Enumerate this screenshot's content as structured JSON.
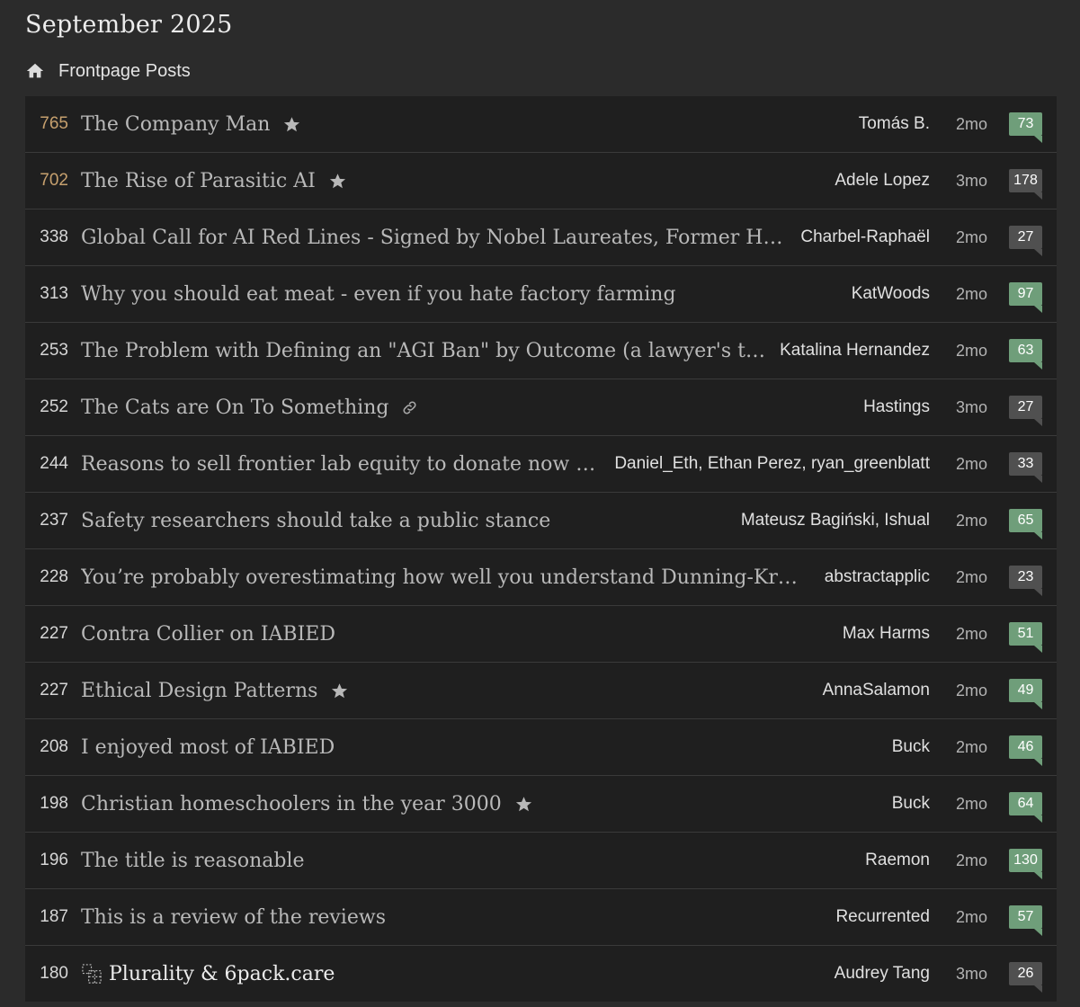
{
  "month_title": "September 2025",
  "section": {
    "icon": "home-icon",
    "label": "Frontpage Posts"
  },
  "colors": {
    "high_karma": "#c6a06e",
    "comments_green": "#6f9e7a",
    "comments_gray": "#505050",
    "row_bg": "#1f1f1f"
  },
  "posts": [
    {
      "karma": "765",
      "title": "The Company Man",
      "author": "Tomás B.",
      "age": "2mo",
      "comments": "73",
      "icon": "star-icon"
    },
    {
      "karma": "702",
      "title": "The Rise of Parasitic AI",
      "author": "Adele Lopez",
      "age": "3mo",
      "comments": "178",
      "icon": "star-icon"
    },
    {
      "karma": "338",
      "title": "Global Call for AI Red Lines - Signed by Nobel Laureates, Former Heads…",
      "author": "Charbel-Raphaël",
      "age": "2mo",
      "comments": "27"
    },
    {
      "karma": "313",
      "title": "Why you should eat meat - even if you hate factory farming",
      "author": "KatWoods",
      "age": "2mo",
      "comments": "97"
    },
    {
      "karma": "253",
      "title": "The Problem with Defining an \"AGI Ban\" by Outcome (a lawyer's take…",
      "author": "Katalina Hernandez",
      "age": "2mo",
      "comments": "63"
    },
    {
      "karma": "252",
      "title": "The Cats are On To Something",
      "author": "Hastings",
      "age": "3mo",
      "comments": "27",
      "icon": "link-icon"
    },
    {
      "karma": "244",
      "title": "Reasons to sell frontier lab equity to donate now rat…",
      "author": "Daniel_Eth, Ethan Perez, ryan_greenblatt",
      "age": "2mo",
      "comments": "33"
    },
    {
      "karma": "237",
      "title": "Safety researchers should take a public stance",
      "author": "Mateusz Bagiński, Ishual",
      "age": "2mo",
      "comments": "65"
    },
    {
      "karma": "228",
      "title": "You’re probably overestimating how well you understand Dunning-Kruger",
      "author": "abstractapplic",
      "age": "2mo",
      "comments": "23"
    },
    {
      "karma": "227",
      "title": "Contra Collier on IABIED",
      "author": "Max Harms",
      "age": "2mo",
      "comments": "51"
    },
    {
      "karma": "227",
      "title": "Ethical Design Patterns",
      "author": "AnnaSalamon",
      "age": "2mo",
      "comments": "49",
      "icon": "star-icon"
    },
    {
      "karma": "208",
      "title": "I enjoyed most of IABIED",
      "author": "Buck",
      "age": "2mo",
      "comments": "46"
    },
    {
      "karma": "198",
      "title": "Christian homeschoolers in the year 3000",
      "author": "Buck",
      "age": "2mo",
      "comments": "64",
      "icon": "star-icon"
    },
    {
      "karma": "196",
      "title": "The title is reasonable",
      "author": "Raemon",
      "age": "2mo",
      "comments": "130"
    },
    {
      "karma": "187",
      "title": "This is a review of the reviews",
      "author": "Recurrented",
      "age": "2mo",
      "comments": "57"
    },
    {
      "karma": "180",
      "title": "Plurality & 6pack.care",
      "author": "Audrey Tang",
      "age": "3mo",
      "comments": "26",
      "lead_icon": "dashed-grid-icon"
    }
  ]
}
